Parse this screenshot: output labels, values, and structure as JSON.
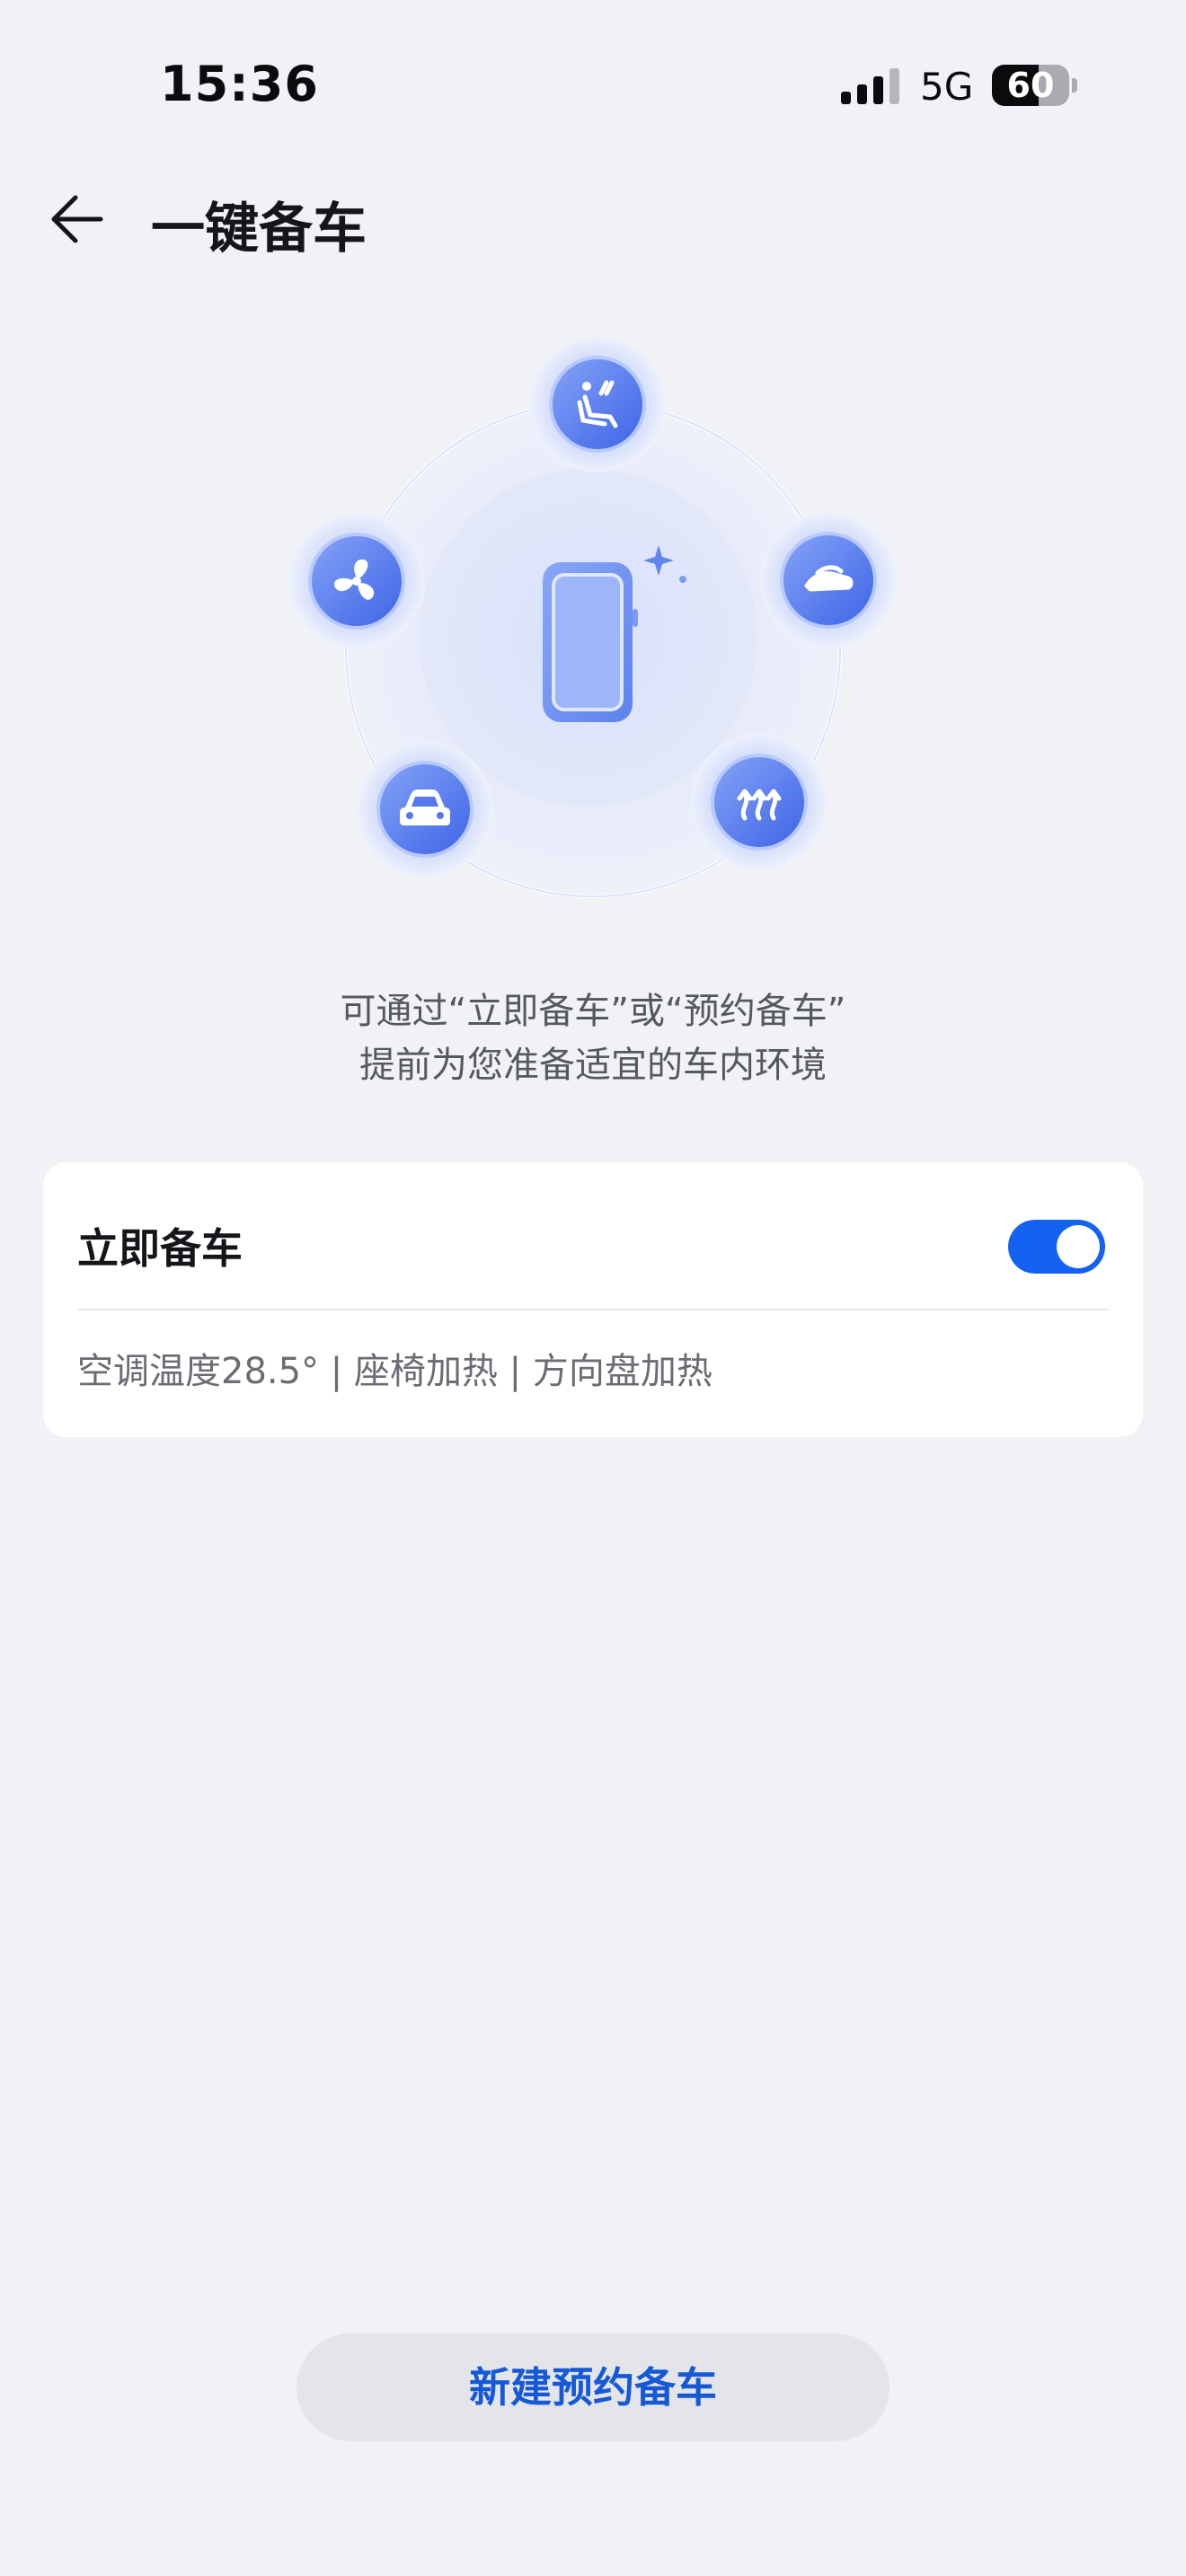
{
  "status_bar": {
    "time": "15:36",
    "network": "5G",
    "battery_level": "60",
    "battery_fraction": 0.6,
    "signal_icon": "cellular-signal-icon"
  },
  "header": {
    "back_icon": "arrow-left-icon",
    "title": "一键备车"
  },
  "hero": {
    "center_icon": "phone-icon",
    "feature_icons": [
      "seat-heating-icon",
      "steering-wheel-heating-icon",
      "defrost-icon",
      "car-icon",
      "fan-icon"
    ]
  },
  "description": {
    "line1": "可通过“立即备车”或“预约备车”",
    "line2": "提前为您准备适宜的车内环境"
  },
  "instant_card": {
    "title": "立即备车",
    "toggle_on": true,
    "detail": "空调温度28.5° | 座椅加热 | 方向盘加热"
  },
  "bottom": {
    "new_schedule_label": "新建预约备车"
  },
  "colors": {
    "background": "#f1f2f5",
    "accent": "#1462f2",
    "button_text": "#1659d6",
    "icon_blue": "#4d76ee"
  }
}
